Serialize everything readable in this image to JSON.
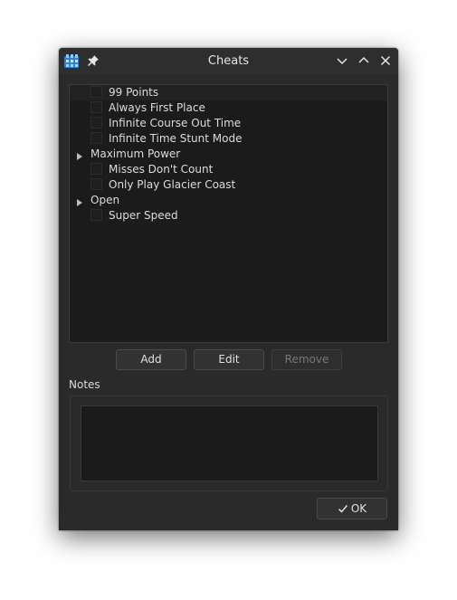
{
  "window": {
    "title": "Cheats"
  },
  "cheats_list": {
    "items": [
      {
        "label": "99 Points",
        "type": "cheat",
        "checked": false
      },
      {
        "label": "Always First Place",
        "type": "cheat",
        "checked": false
      },
      {
        "label": "Infinite Course Out Time",
        "type": "cheat",
        "checked": false
      },
      {
        "label": "Infinite Time Stunt Mode",
        "type": "cheat",
        "checked": false
      },
      {
        "label": "Maximum Power",
        "type": "group",
        "expanded": false
      },
      {
        "label": "Misses Don't Count",
        "type": "cheat",
        "checked": false
      },
      {
        "label": "Only Play Glacier Coast",
        "type": "cheat",
        "checked": false
      },
      {
        "label": "Open",
        "type": "group",
        "expanded": false
      },
      {
        "label": "Super Speed",
        "type": "cheat",
        "checked": false
      }
    ]
  },
  "buttons": {
    "add": "Add",
    "edit": "Edit",
    "remove": "Remove",
    "ok": "OK"
  },
  "notes": {
    "label": "Notes",
    "value": ""
  },
  "icons": {
    "app": "app-logo-icon",
    "pin": "pin-icon",
    "minimize": "chevron-down-icon",
    "maximize": "chevron-up-icon",
    "close": "close-icon",
    "expand": "triangle-right-icon",
    "ok": "check-icon"
  },
  "colors": {
    "window_bg": "#2a2a2a",
    "titlebar_bg": "#2e2e2e",
    "list_bg": "#1b1b1b",
    "text": "#dcdcdc",
    "disabled_text": "#777777"
  }
}
